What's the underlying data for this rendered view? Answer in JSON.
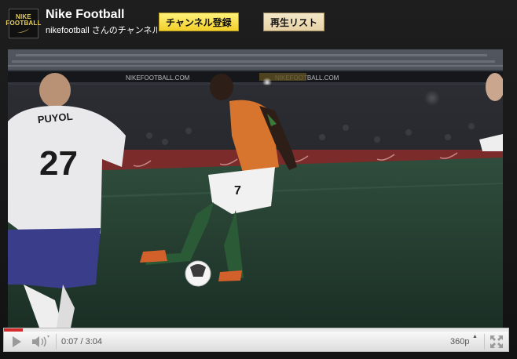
{
  "header": {
    "logo_line1": "NIKE",
    "logo_line2": "FOOTBALL",
    "title": "Nike Football",
    "subtitle": "nikefootball さんのチャンネル",
    "subscribe_label": "チャンネル登録",
    "playlist_label": "再生リスト"
  },
  "video": {
    "player_name": "PUYOL",
    "player_number": "27",
    "striker_number": "7",
    "banner_text": "NIKEFOOTBALL.COM",
    "icon": "video-frame"
  },
  "controls": {
    "current_time": "0:07",
    "separator": "/",
    "duration": "3:04",
    "time_text": "0:07 / 3:04",
    "quality": "360p",
    "progress_fraction": 0.038,
    "play_icon": "play-icon",
    "volume_icon": "volume-icon",
    "fullscreen_icon": "fullscreen-icon"
  },
  "colors": {
    "accent": "#d42a2a",
    "subscribe_bg": "#f5d838",
    "playlist_bg": "#ecdcb4",
    "background": "#161616"
  }
}
